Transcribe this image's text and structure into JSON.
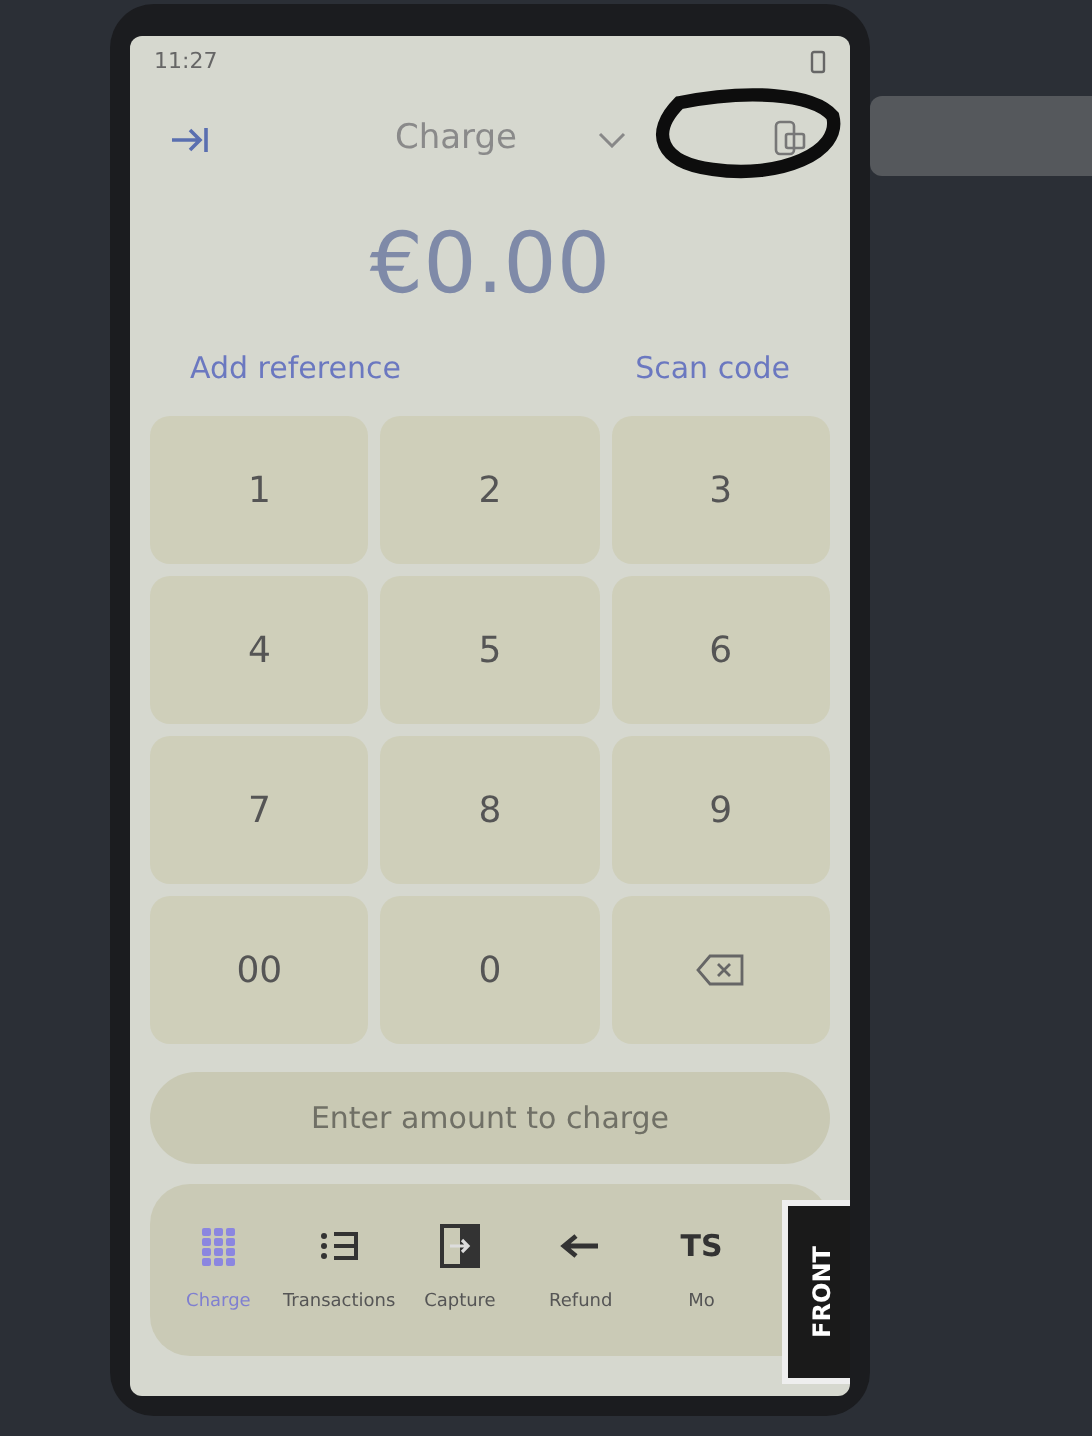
{
  "status_bar": {
    "time": "11:27"
  },
  "header": {
    "title": "Charge"
  },
  "amount": "€0.00",
  "actions": [
    "Add reference",
    "Scan code"
  ],
  "keypad": [
    {
      "kind": "digit",
      "label": "1"
    },
    {
      "kind": "digit",
      "label": "2"
    },
    {
      "kind": "digit",
      "label": "3"
    },
    {
      "kind": "digit",
      "label": "4"
    },
    {
      "kind": "digit",
      "label": "5"
    },
    {
      "kind": "digit",
      "label": "6"
    },
    {
      "kind": "digit",
      "label": "7"
    },
    {
      "kind": "digit",
      "label": "8"
    },
    {
      "kind": "digit",
      "label": "9"
    },
    {
      "kind": "digit",
      "label": "00"
    },
    {
      "kind": "digit",
      "label": "0"
    },
    {
      "kind": "backspace"
    }
  ],
  "amount_field": {
    "placeholder": "Enter amount to charge"
  },
  "nav": [
    {
      "kind": "grid",
      "label": "Charge",
      "selected": true
    },
    {
      "kind": "list",
      "label": "Transactions",
      "selected": false
    },
    {
      "kind": "capture",
      "label": "Capture",
      "selected": false
    },
    {
      "kind": "arrow",
      "label": "Refund",
      "selected": false
    },
    {
      "kind": "text",
      "icon_text": "TS",
      "label": "Mo",
      "selected": false
    }
  ],
  "sticker": {
    "label": "FRONT"
  }
}
